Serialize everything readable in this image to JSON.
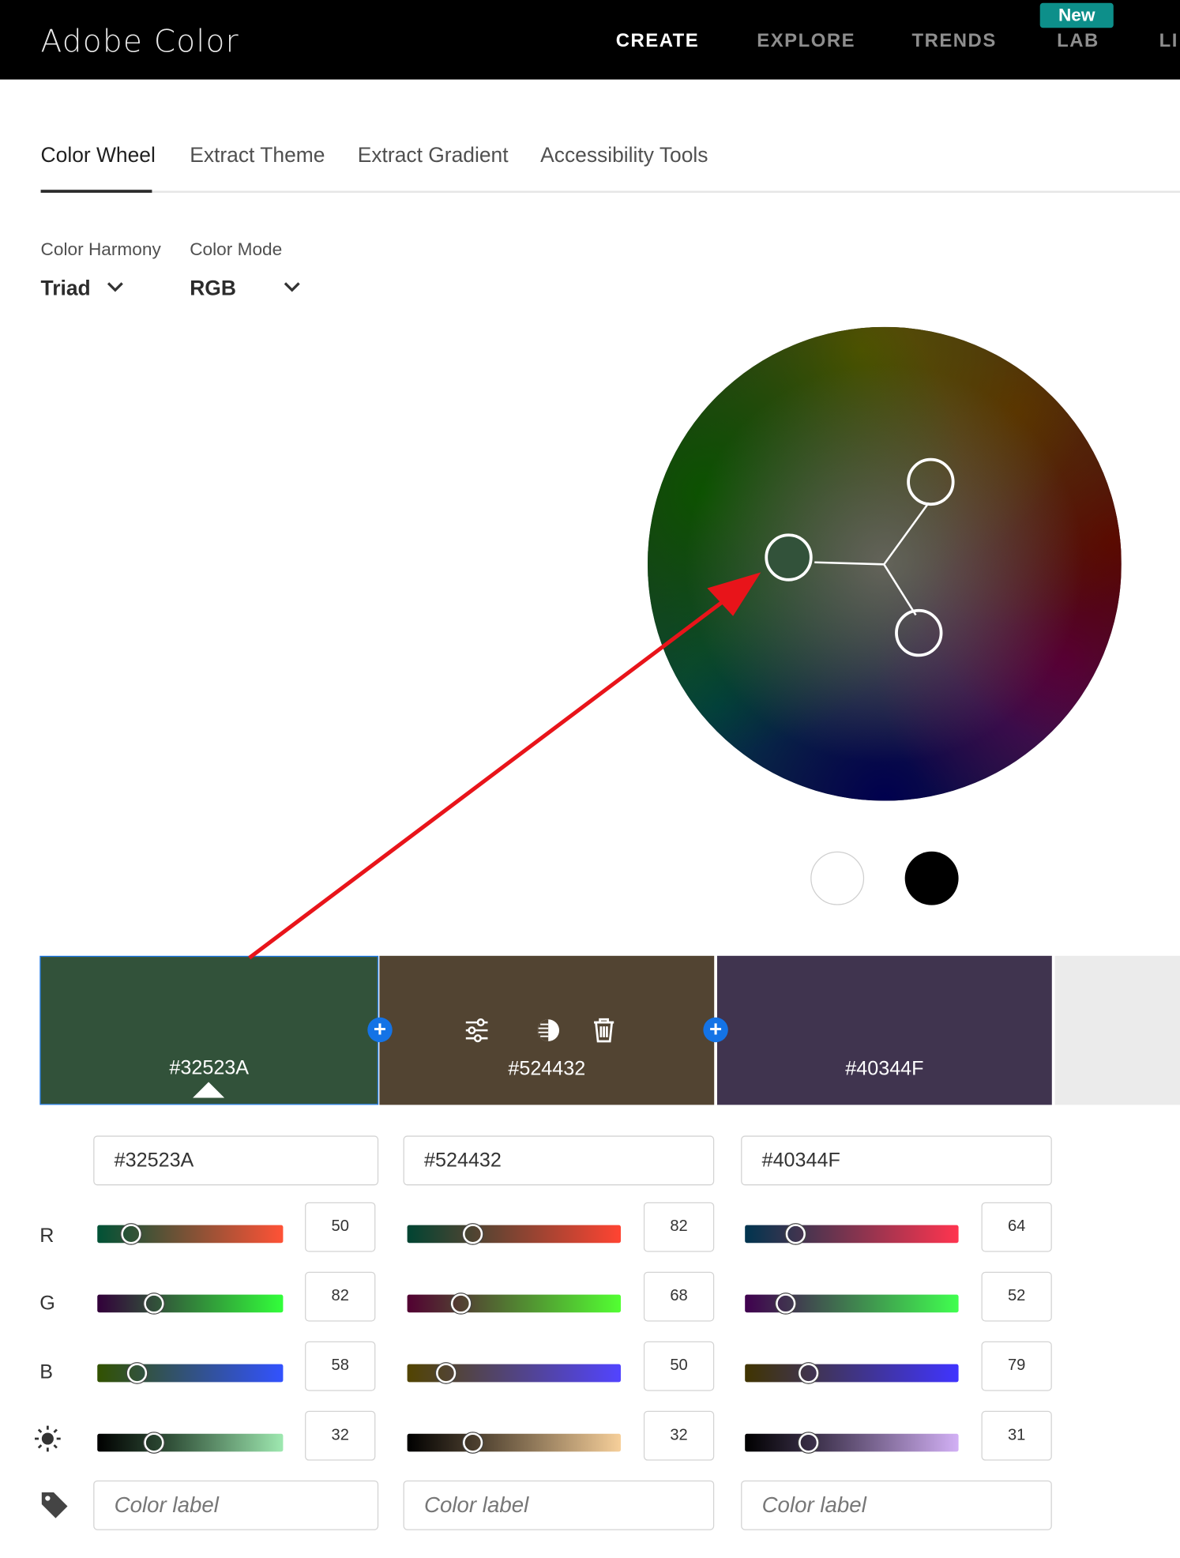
{
  "header": {
    "brand": "Adobe Color",
    "nav": [
      "CREATE",
      "EXPLORE",
      "TRENDS",
      "LAB",
      "LI"
    ],
    "badge": "New"
  },
  "tabs": [
    "Color Wheel",
    "Extract Theme",
    "Extract Gradient",
    "Accessibility Tools"
  ],
  "controls": {
    "harmony_label": "Color Harmony",
    "harmony_value": "Triad",
    "mode_label": "Color Mode",
    "mode_value": "RGB"
  },
  "swatches": [
    {
      "hex": "#32523A",
      "color": "#32523A"
    },
    {
      "hex": "#524432",
      "color": "#524432"
    },
    {
      "hex": "#40344F",
      "color": "#40344F"
    }
  ],
  "row_labels": {
    "r": "R",
    "g": "G",
    "b": "B"
  },
  "columns": [
    {
      "hex": "#32523A",
      "r": "50",
      "g": "82",
      "b": "58",
      "brightness": "32",
      "label_placeholder": "Color label"
    },
    {
      "hex": "#524432",
      "r": "82",
      "g": "68",
      "b": "50",
      "brightness": "32",
      "label_placeholder": "Color label"
    },
    {
      "hex": "#40344F",
      "r": "64",
      "g": "52",
      "b": "79",
      "brightness": "31",
      "label_placeholder": "Color label"
    }
  ],
  "icons": [
    "chevron-down-icon",
    "sliders-icon",
    "contrast-icon",
    "trash-icon",
    "plus-icon",
    "sun-icon",
    "tag-icon"
  ],
  "colors": {
    "accent": "#1473e6",
    "badge": "#0d8f8a",
    "annotation_arrow": "#e8141a"
  }
}
